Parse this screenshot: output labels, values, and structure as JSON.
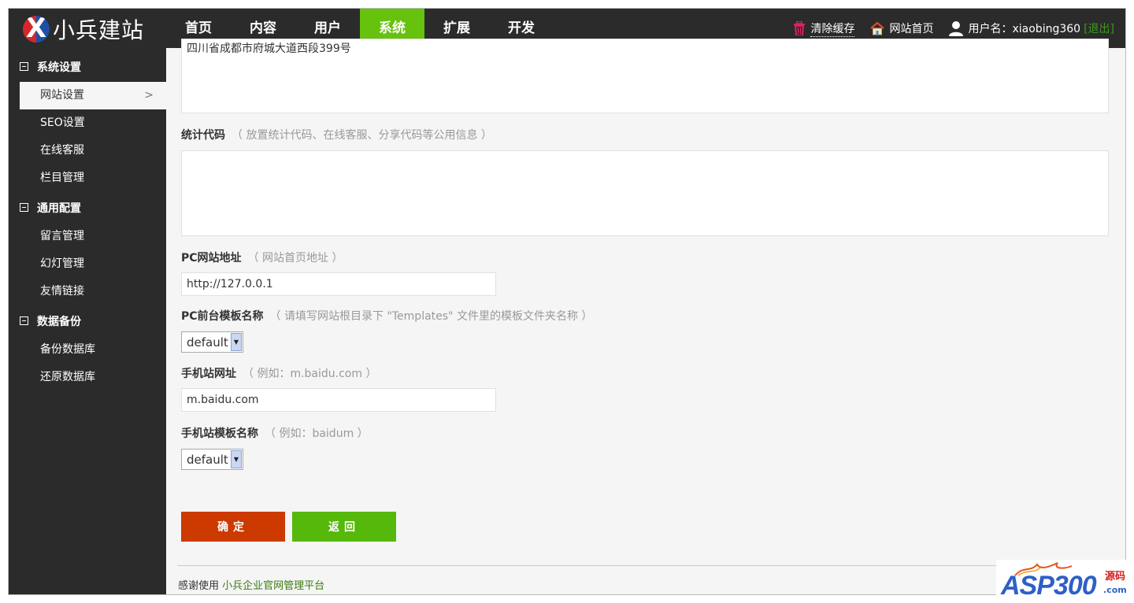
{
  "brand": {
    "name": "小兵建站",
    "mark": "X"
  },
  "nav": [
    {
      "label": "首页"
    },
    {
      "label": "内容"
    },
    {
      "label": "用户"
    },
    {
      "label": "系统",
      "active": true
    },
    {
      "label": "扩展"
    },
    {
      "label": "开发"
    }
  ],
  "topbar": {
    "clear_cache": "清除缓存",
    "site_home": "网站首页",
    "user_label": "用户名：xiaobing360",
    "logout": "[退出]"
  },
  "sidebar": {
    "sections": [
      {
        "title": "系统设置",
        "items": [
          "网站设置",
          "SEO设置",
          "在线客服",
          "栏目管理"
        ],
        "active_index": 0
      },
      {
        "title": "通用配置",
        "items": [
          "留言管理",
          "幻灯管理",
          "友情链接"
        ]
      },
      {
        "title": "数据备份",
        "items": [
          "备份数据库",
          "还原数据库"
        ]
      }
    ],
    "active_chevron": ">"
  },
  "form": {
    "address_value": "四川省成都市府城大道西段399号",
    "stats_code": {
      "label": "统计代码",
      "hint": "（ 放置统计代码、在线客服、分享代码等公用信息 ）",
      "value": ""
    },
    "pc_url": {
      "label": "PC网站地址",
      "hint": "（ 网站首页地址 ）",
      "value": "http://127.0.0.1"
    },
    "pc_template": {
      "label": "PC前台模板名称",
      "hint": "（ 请填写网站根目录下 \"Templates\" 文件里的模板文件夹名称 ）",
      "value": "default"
    },
    "mobile_url": {
      "label": "手机站网址",
      "hint": "（ 例如：m.baidu.com ）",
      "value": "m.baidu.com"
    },
    "mobile_template": {
      "label": "手机站模板名称",
      "hint": "（ 例如：baidum ）",
      "value": "default"
    },
    "ok_button": "确定",
    "back_button": "返回"
  },
  "footer": {
    "prefix": "感谢使用",
    "link": "小兵企业官网管理平台"
  },
  "watermark": {
    "text": "ASP300",
    "side": "源码",
    "domain": ".com"
  },
  "colors": {
    "nav_bg": "#2b2b2b",
    "active_green": "#66c20c",
    "ok_red": "#cc3a00",
    "back_green": "#56b80a"
  }
}
